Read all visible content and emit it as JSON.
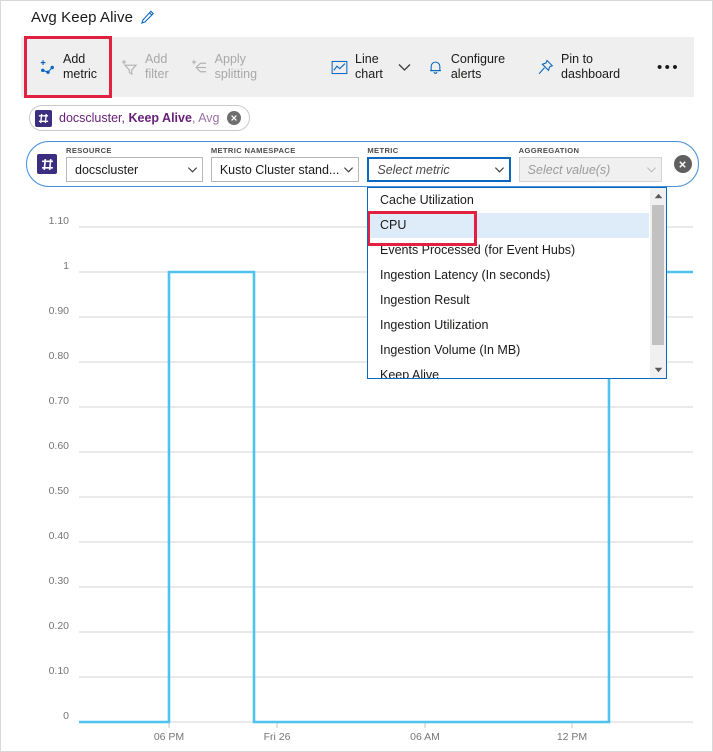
{
  "header": {
    "title": "Avg Keep Alive",
    "edit_icon": "pencil-icon"
  },
  "toolbar": {
    "buttons": [
      {
        "label": "Add\nmetric",
        "icon": "add-metric-icon",
        "disabled": false,
        "highlighted": true
      },
      {
        "label": "Add\nfilter",
        "icon": "add-filter-icon",
        "disabled": true,
        "highlighted": false
      },
      {
        "label": "Apply\nsplitting",
        "icon": "apply-splitting-icon",
        "disabled": true,
        "highlighted": false
      },
      {
        "label": "Line\nchart",
        "icon": "line-chart-icon",
        "disabled": false,
        "highlighted": false
      },
      {
        "label": "Configure\nalerts",
        "icon": "bell-icon",
        "disabled": false,
        "highlighted": false
      },
      {
        "label": "Pin to\ndashboard",
        "icon": "pin-icon",
        "disabled": false,
        "highlighted": false
      }
    ],
    "more_label": "•••"
  },
  "chip": {
    "resource": "docscluster, ",
    "metric": "Keep Alive",
    "aggregation": ", Avg",
    "close_icon": "close-icon"
  },
  "selector": {
    "fields": [
      {
        "label": "RESOURCE",
        "value": "docscluster",
        "state": "normal"
      },
      {
        "label": "METRIC NAMESPACE",
        "value": "Kusto Cluster stand...",
        "state": "normal"
      },
      {
        "label": "METRIC",
        "value": "Select metric",
        "state": "placeholder"
      },
      {
        "label": "AGGREGATION",
        "value": "Select value(s)",
        "state": "disabled"
      }
    ],
    "close_icon": "close-icon"
  },
  "dropdown": {
    "items": [
      {
        "label": "Cache Utilization",
        "selected": false,
        "highlighted": false
      },
      {
        "label": "CPU",
        "selected": true,
        "highlighted": true
      },
      {
        "label": "Events Processed (for Event Hubs)",
        "selected": false,
        "highlighted": false
      },
      {
        "label": "Ingestion Latency (In seconds)",
        "selected": false,
        "highlighted": false
      },
      {
        "label": "Ingestion Result",
        "selected": false,
        "highlighted": false
      },
      {
        "label": "Ingestion Utilization",
        "selected": false,
        "highlighted": false
      },
      {
        "label": "Ingestion Volume (In MB)",
        "selected": false,
        "highlighted": false
      },
      {
        "label": "Keep Alive",
        "selected": false,
        "highlighted": false
      }
    ],
    "scroll_up_icon": "scroll-up-arrow-icon",
    "scroll_down_icon": "scroll-down-arrow-icon"
  },
  "colors": {
    "accent": "#0a68c1",
    "series": "#4ec3f0",
    "highlight": "#e2203f",
    "chip_text": "#68217a",
    "toolbar_bg": "#efefef"
  },
  "chart_data": {
    "type": "line",
    "title": "",
    "xlabel": "",
    "ylabel": "",
    "ylim": [
      0,
      1.1
    ],
    "yticks": [
      "0",
      "0.10",
      "0.20",
      "0.30",
      "0.40",
      "0.50",
      "0.60",
      "0.70",
      "0.80",
      "0.90",
      "1",
      "1.10"
    ],
    "ytick_values": [
      0,
      0.1,
      0.2,
      0.3,
      0.4,
      0.5,
      0.6,
      0.7,
      0.8,
      0.9,
      1.0,
      1.1
    ],
    "xticks": [
      "06 PM",
      "Fri 26",
      "06 AM",
      "12 PM"
    ],
    "xtick_positions": [
      168,
      276,
      424,
      571
    ],
    "grid": true,
    "legend": null,
    "series": [
      {
        "name": "docscluster, Keep Alive, Avg",
        "color": "#4ec3f0",
        "step": "post",
        "points": [
          {
            "x": 78,
            "y": 0
          },
          {
            "x": 168,
            "y": 0
          },
          {
            "x": 168,
            "y": 1
          },
          {
            "x": 253,
            "y": 1
          },
          {
            "x": 253,
            "y": 0
          },
          {
            "x": 608,
            "y": 0
          },
          {
            "x": 608,
            "y": 1
          },
          {
            "x": 692,
            "y": 1
          }
        ]
      }
    ]
  }
}
